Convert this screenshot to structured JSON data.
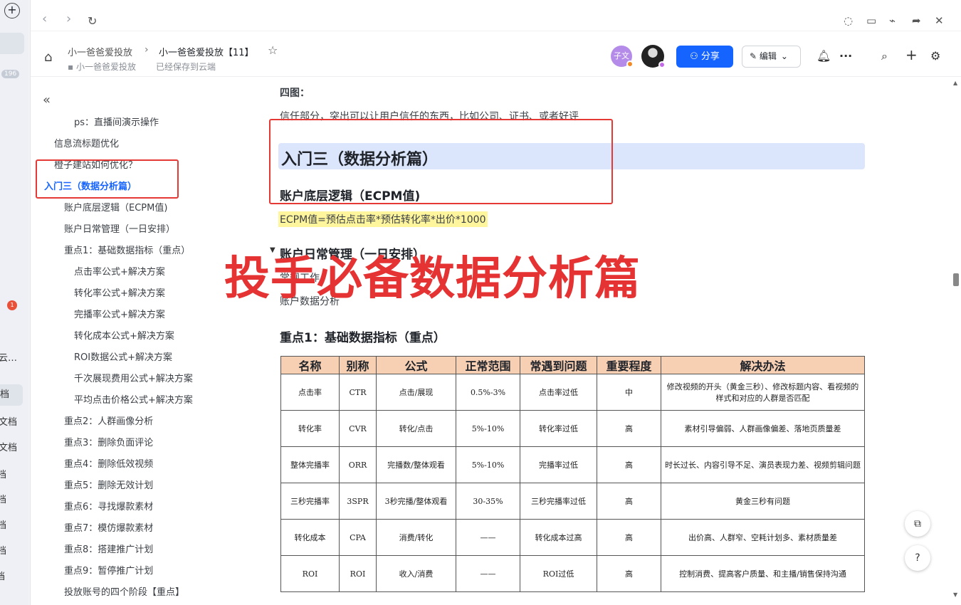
{
  "rail": {
    "badge_count": "196",
    "notify_count": "1",
    "labels": [
      "云…",
      "档",
      "文档",
      "文档",
      "档",
      "档",
      "档",
      "档",
      "档"
    ]
  },
  "titlebar": {
    "back": "‹",
    "forward": "›",
    "refresh": "↻"
  },
  "header": {
    "breadcrumb_parent": "小一爸爸爱投放",
    "breadcrumb_current": "小一爸爸爱投放【11】",
    "folder": "小一爸爸爱投放",
    "save_status": "已经保存到云端",
    "avatar_text": "子文",
    "share_label": "分享",
    "edit_label": "编辑"
  },
  "toc": {
    "items": [
      {
        "label": "ps：直播间演示操作"
      },
      {
        "label": "信息流标题优化"
      },
      {
        "label": "橙子建站如何优化？"
      },
      {
        "label": "入门三（数据分析篇）"
      },
      {
        "label": "账户底层逻辑（ECPM值)"
      },
      {
        "label": "账户日常管理（一日安排）"
      },
      {
        "label": "重点1：基础数据指标（重点）"
      },
      {
        "label": "点击率公式+解决方案"
      },
      {
        "label": "转化率公式+解决方案"
      },
      {
        "label": "完播率公式+解决方案"
      },
      {
        "label": "转化成本公式+解决方案"
      },
      {
        "label": "ROI数据公式+解决方案"
      },
      {
        "label": "千次展现费用公式+解决方案"
      },
      {
        "label": "平均点击价格公式+解决方案"
      },
      {
        "label": "重点2：人群画像分析"
      },
      {
        "label": "重点3：删除负面评论"
      },
      {
        "label": "重点4：删除低效视频"
      },
      {
        "label": "重点5：删除无效计划"
      },
      {
        "label": "重点6：寻找爆款素材"
      },
      {
        "label": "重点7：模仿爆款素材"
      },
      {
        "label": "重点8：搭建推广计划"
      },
      {
        "label": "重点9：暂停推广计划"
      },
      {
        "label": "投放账号的四个阶段【重点】"
      }
    ]
  },
  "content": {
    "four_title": "四图：",
    "trust_text": "信任部分，突出可以让用户信任的东西，比如公司、证书、或者好评",
    "h1": "入门三（数据分析篇）",
    "h_ecpm": "账户底层逻辑（ECPM值)",
    "formula": "ECPM值=预估点击率*预估转化率*出价*1000",
    "h_daily": "账户日常管理（一日安排）",
    "routine": "常规工作",
    "account_analysis": "账户数据分析",
    "h_key1": "重点1：基础数据指标（重点）",
    "overlay": "投手必备数据分析篇"
  },
  "table": {
    "headers": [
      "名称",
      "别称",
      "公式",
      "正常范围",
      "常遇到问题",
      "重要程度",
      "解决办法"
    ],
    "rows": [
      {
        "c0": "点击率",
        "c1": "CTR",
        "c2": "点击/展现",
        "c3": "0.5%-3%",
        "c4": "点击率过低",
        "c5": "中",
        "c6": "修改视频的开头（黄金三秒）、修改标题内容、看视频的样式和对应的人群是否匹配"
      },
      {
        "c0": "转化率",
        "c1": "CVR",
        "c2": "转化/点击",
        "c3": "5%-10%",
        "c4": "转化率过低",
        "c5": "高",
        "c6": "素材引导偏弱、人群画像偏差、落地页质量差"
      },
      {
        "c0": "整体完播率",
        "c1": "ORR",
        "c2": "完播数/整体观看",
        "c3": "5%-10%",
        "c4": "完播率过低",
        "c5": "高",
        "c6": "时长过长、内容引导不足、演员表现力差、视频剪辑问题"
      },
      {
        "c0": "三秒完播率",
        "c1": "3SPR",
        "c2": "3秒完播/整体观看",
        "c3": "30-35%",
        "c4": "三秒完播率过低",
        "c5": "高",
        "c6": "黄金三秒有问题"
      },
      {
        "c0": "转化成本",
        "c1": "CPA",
        "c2": "消费/转化",
        "c3": "——",
        "c4": "转化成本过高",
        "c5": "高",
        "c6": "出价高、人群窄、空耗计划多、素材质量差"
      },
      {
        "c0": "ROI",
        "c1": "ROI",
        "c2": "收入/消费",
        "c3": "——",
        "c4": "ROI过低",
        "c5": "高",
        "c6": "控制消费、提高客户质量、和主播/销售保持沟通"
      }
    ]
  }
}
